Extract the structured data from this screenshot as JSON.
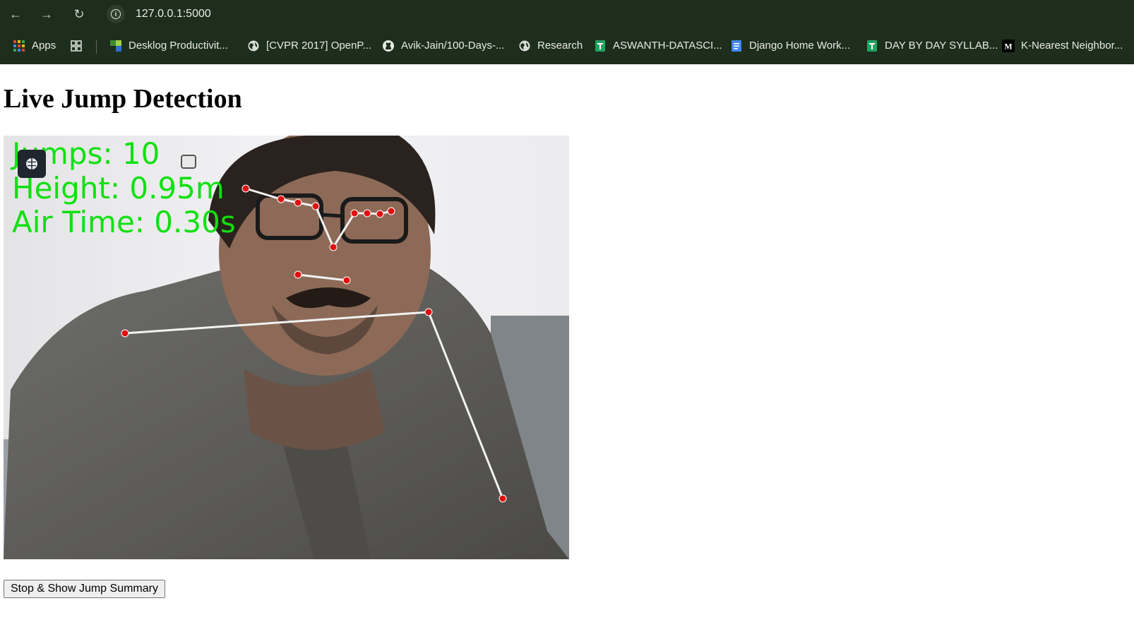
{
  "browser": {
    "url": "127.0.0.1:5000",
    "nav": {
      "back_icon": "arrow-left-icon",
      "forward_icon": "arrow-right-icon",
      "reload_icon": "reload-icon",
      "info_icon": "info-icon"
    }
  },
  "bookmarks": [
    {
      "label": "Apps",
      "icon": "apps-grid-icon"
    },
    {
      "label": "",
      "icon": "tab-groups-icon"
    },
    {
      "label": "Desklog Productivit...",
      "icon": "desklog-icon"
    },
    {
      "label": "[CVPR 2017] OpenP...",
      "icon": "globe-icon"
    },
    {
      "label": "Avik-Jain/100-Days-...",
      "icon": "github-icon"
    },
    {
      "label": "Research",
      "icon": "globe-icon"
    },
    {
      "label": "ASWANTH-DATASCI...",
      "icon": "sheets-icon"
    },
    {
      "label": "Django Home Work...",
      "icon": "docs-icon"
    },
    {
      "label": "DAY BY DAY SYLLAB...",
      "icon": "sheets-icon"
    },
    {
      "label": "K-Nearest Neighbor...",
      "icon": "medium-icon"
    }
  ],
  "page": {
    "title": "Live Jump Detection",
    "stats": {
      "jumps": "Jumps: 10",
      "height": "Height: 0.95m",
      "air_time": "Air Time: 0.30s"
    },
    "button_label": "Stop & Show Jump Summary"
  },
  "colors": {
    "chrome": "#1e2e1c",
    "overlay_text": "#10e010",
    "keypoint": "#e01010",
    "skeleton": "#f2f2f2"
  }
}
